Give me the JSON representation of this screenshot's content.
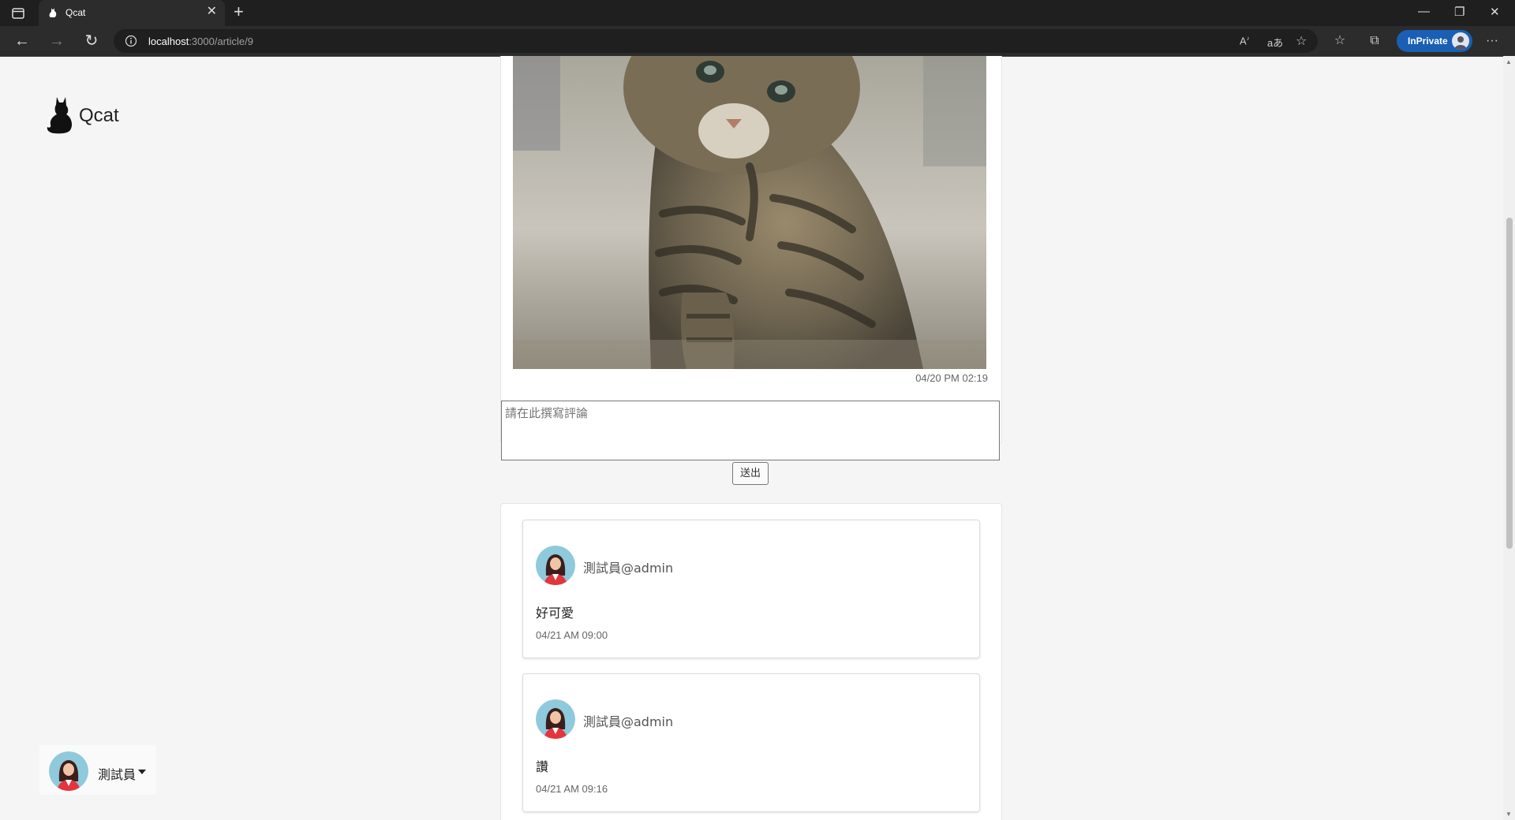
{
  "browser": {
    "tab_title": "Qcat",
    "url_host": "localhost",
    "url_path": ":3000/article/9",
    "inprivate_label": "InPrivate"
  },
  "site": {
    "logo_text": "Qcat"
  },
  "article": {
    "timestamp": "04/20 PM 02:19"
  },
  "comment_form": {
    "placeholder": "請在此撰寫評論",
    "submit_label": "送出"
  },
  "comments": [
    {
      "author": "測試員@admin",
      "text": "好可愛",
      "time": "04/21 AM 09:00"
    },
    {
      "author": "測試員@admin",
      "text": "讚",
      "time": "04/21 AM 09:16"
    }
  ],
  "user_menu": {
    "name": "測試員"
  },
  "icons": {
    "tab_actions": "tab-actions-icon",
    "favicon": "cat-favicon-icon",
    "back": "back-arrow-icon",
    "forward": "forward-arrow-icon",
    "refresh": "refresh-icon",
    "info": "info-icon",
    "read_aloud": "read-aloud-icon",
    "translate": "translate-icon",
    "add_favorite": "add-favorite-icon",
    "favorites": "favorites-icon",
    "collections": "collections-icon",
    "more": "more-icon"
  },
  "colors": {
    "accent": "#1a5fb4",
    "page_bg": "#f5f5f5"
  }
}
